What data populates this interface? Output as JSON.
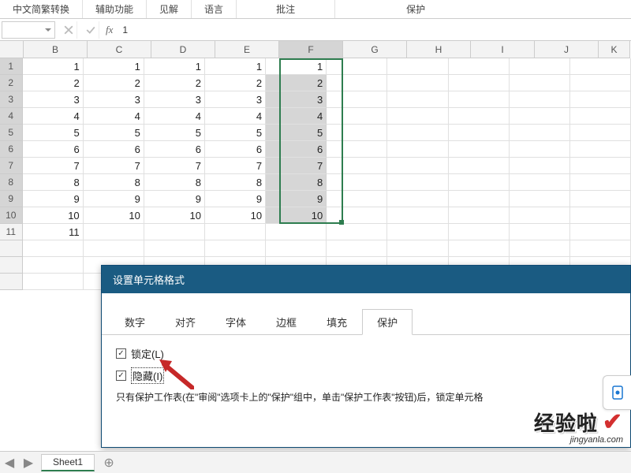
{
  "ribbon": {
    "groups": [
      "中文简繁转换",
      "辅助功能",
      "见解",
      "语言",
      "批注",
      "保护"
    ]
  },
  "formula_bar": {
    "name_box": "",
    "fx_label": "fx",
    "value": "1"
  },
  "columns": [
    "B",
    "C",
    "D",
    "E",
    "F",
    "G",
    "H",
    "I",
    "J",
    "K"
  ],
  "selected_col_index": 4,
  "rows": [
    {
      "n": "1",
      "sel": true,
      "c": [
        "1",
        "1",
        "1",
        "1",
        "1",
        "",
        "",
        "",
        "",
        ""
      ]
    },
    {
      "n": "2",
      "sel": true,
      "c": [
        "2",
        "2",
        "2",
        "2",
        "2",
        "",
        "",
        "",
        "",
        ""
      ]
    },
    {
      "n": "3",
      "sel": true,
      "c": [
        "3",
        "3",
        "3",
        "3",
        "3",
        "",
        "",
        "",
        "",
        ""
      ]
    },
    {
      "n": "4",
      "sel": true,
      "c": [
        "4",
        "4",
        "4",
        "4",
        "4",
        "",
        "",
        "",
        "",
        ""
      ]
    },
    {
      "n": "5",
      "sel": true,
      "c": [
        "5",
        "5",
        "5",
        "5",
        "5",
        "",
        "",
        "",
        "",
        ""
      ]
    },
    {
      "n": "6",
      "sel": true,
      "c": [
        "6",
        "6",
        "6",
        "6",
        "6",
        "",
        "",
        "",
        "",
        ""
      ]
    },
    {
      "n": "7",
      "sel": true,
      "c": [
        "7",
        "7",
        "7",
        "7",
        "7",
        "",
        "",
        "",
        "",
        ""
      ]
    },
    {
      "n": "8",
      "sel": true,
      "c": [
        "8",
        "8",
        "8",
        "8",
        "8",
        "",
        "",
        "",
        "",
        ""
      ]
    },
    {
      "n": "9",
      "sel": true,
      "c": [
        "9",
        "9",
        "9",
        "9",
        "9",
        "",
        "",
        "",
        "",
        ""
      ]
    },
    {
      "n": "10",
      "sel": true,
      "c": [
        "10",
        "10",
        "10",
        "10",
        "10",
        "",
        "",
        "",
        "",
        ""
      ]
    },
    {
      "n": "11",
      "sel": false,
      "c": [
        "11",
        "",
        "",
        "",
        "",
        "",
        "",
        "",
        "",
        ""
      ]
    },
    {
      "n": "",
      "sel": false,
      "c": [
        "",
        "",
        "",
        "",
        "",
        "",
        "",
        "",
        "",
        ""
      ]
    },
    {
      "n": "",
      "sel": false,
      "c": [
        "",
        "",
        "",
        "",
        "",
        "",
        "",
        "",
        "",
        ""
      ]
    },
    {
      "n": "",
      "sel": false,
      "c": [
        "",
        "",
        "",
        "",
        "",
        "",
        "",
        "",
        "",
        ""
      ]
    }
  ],
  "dialog": {
    "title": "设置单元格格式",
    "tabs": [
      "数字",
      "对齐",
      "字体",
      "边框",
      "填充",
      "保护"
    ],
    "active_tab": 5,
    "lock_label": "锁定(L)",
    "hide_label": "隐藏(I)",
    "desc": "只有保护工作表(在\"审阅\"选项卡上的\"保护\"组中，单击\"保护工作表\"按钮)后，锁定单元格"
  },
  "sheet": {
    "name": "Sheet1"
  },
  "watermark": {
    "main": "经验啦",
    "sub": "jingyanla.com"
  }
}
